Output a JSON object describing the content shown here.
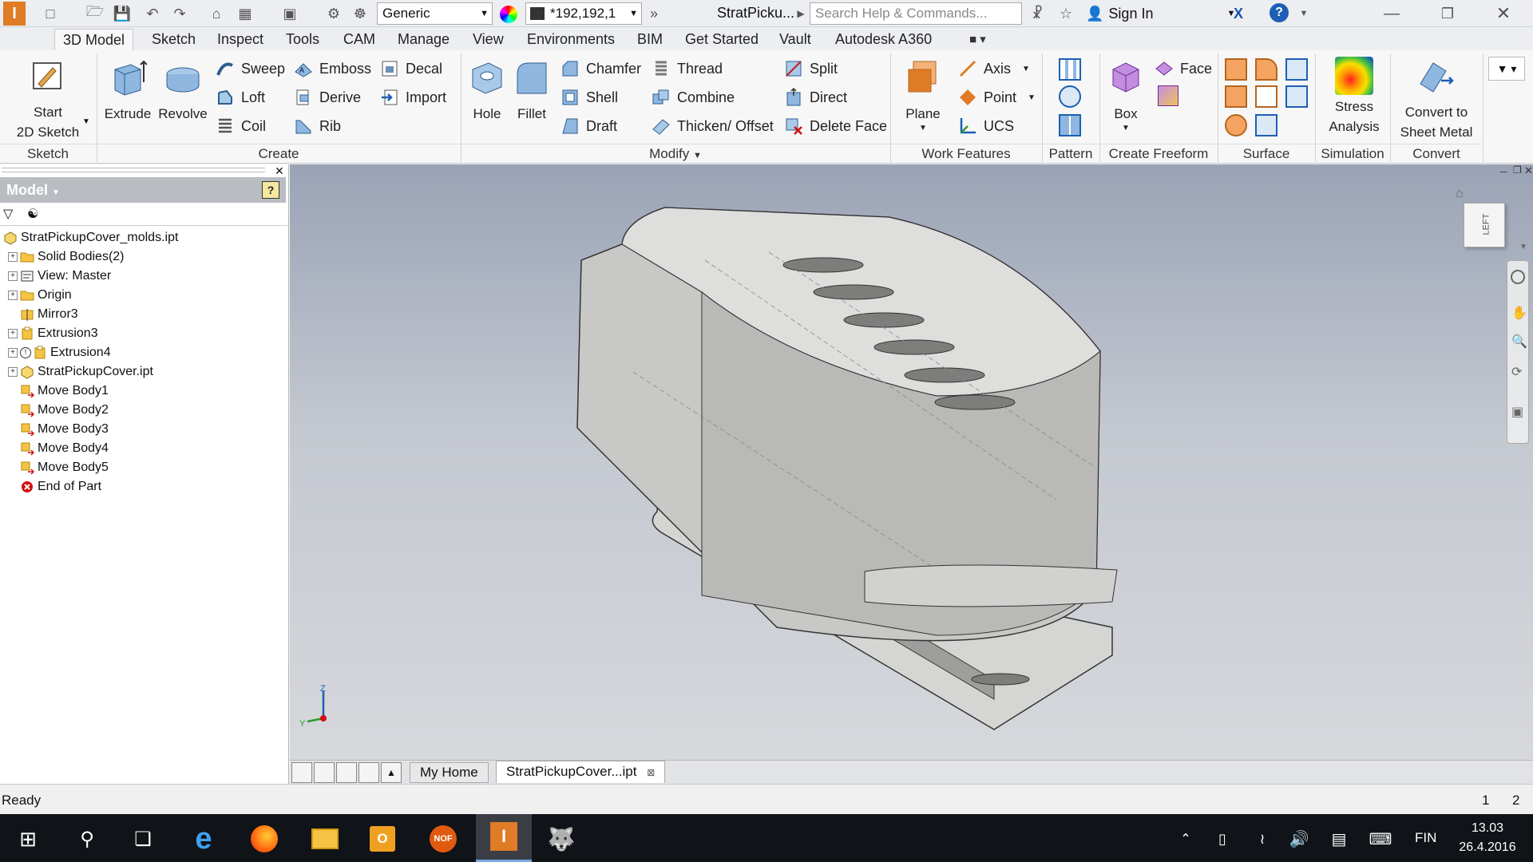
{
  "app": {
    "document_title": "StratPicku...",
    "search_placeholder": "Search Help & Commands...",
    "sign_in": "Sign In",
    "material": "Generic",
    "appearance": "*192,192,1"
  },
  "tabs": [
    {
      "label": "3D Model",
      "active": true
    },
    {
      "label": "Sketch"
    },
    {
      "label": "Inspect"
    },
    {
      "label": "Tools"
    },
    {
      "label": "CAM"
    },
    {
      "label": "Manage"
    },
    {
      "label": "View"
    },
    {
      "label": "Environments"
    },
    {
      "label": "BIM"
    },
    {
      "label": "Get Started"
    },
    {
      "label": "Vault"
    },
    {
      "label": "Autodesk A360"
    }
  ],
  "ribbon": {
    "sketch": {
      "label": "Sketch",
      "start_line1": "Start",
      "start_line2": "2D Sketch"
    },
    "create": {
      "label": "Create",
      "extrude": "Extrude",
      "revolve": "Revolve",
      "sweep": "Sweep",
      "loft": "Loft",
      "coil": "Coil",
      "emboss": "Emboss",
      "derive": "Derive",
      "rib": "Rib",
      "decal": "Decal",
      "import": "Import"
    },
    "modify": {
      "label": "Modify",
      "hole": "Hole",
      "fillet": "Fillet",
      "chamfer": "Chamfer",
      "shell": "Shell",
      "draft": "Draft",
      "thread": "Thread",
      "combine": "Combine",
      "thicken": "Thicken/ Offset",
      "split": "Split",
      "direct": "Direct",
      "delete_face": "Delete Face"
    },
    "work_features": {
      "label": "Work Features",
      "plane": "Plane",
      "axis": "Axis",
      "point": "Point",
      "ucs": "UCS"
    },
    "pattern": {
      "label": "Pattern"
    },
    "freeform": {
      "label": "Create Freeform",
      "box": "Box",
      "face": "Face"
    },
    "surface": {
      "label": "Surface"
    },
    "simulation": {
      "label": "Simulation",
      "stress_line1": "Stress",
      "stress_line2": "Analysis"
    },
    "convert": {
      "label": "Convert",
      "convert_line1": "Convert to",
      "convert_line2": "Sheet Metal"
    }
  },
  "browser": {
    "title": "Model",
    "items": [
      {
        "label": "StratPickupCover_molds.ipt",
        "level": 0,
        "expander": false,
        "icon": "part-icon"
      },
      {
        "label": "Solid Bodies(2)",
        "level": 1,
        "expander": true,
        "icon": "folder-icon"
      },
      {
        "label": "View: Master",
        "level": 1,
        "expander": true,
        "icon": "view-icon"
      },
      {
        "label": "Origin",
        "level": 1,
        "expander": true,
        "icon": "folder-icon"
      },
      {
        "label": "Mirror3",
        "level": 1,
        "expander": false,
        "icon": "mirror-icon"
      },
      {
        "label": "Extrusion3",
        "level": 1,
        "expander": true,
        "icon": "extrude-icon"
      },
      {
        "label": "Extrusion4",
        "level": 1,
        "expander": true,
        "icon": "extrude-icon"
      },
      {
        "label": "StratPickupCover.ipt",
        "level": 1,
        "expander": true,
        "icon": "part-icon"
      },
      {
        "label": "Move Body1",
        "level": 1,
        "expander": false,
        "icon": "move-body-icon"
      },
      {
        "label": "Move Body2",
        "level": 1,
        "expander": false,
        "icon": "move-body-icon"
      },
      {
        "label": "Move Body3",
        "level": 1,
        "expander": false,
        "icon": "move-body-icon"
      },
      {
        "label": "Move Body4",
        "level": 1,
        "expander": false,
        "icon": "move-body-icon"
      },
      {
        "label": "Move Body5",
        "level": 1,
        "expander": false,
        "icon": "move-body-icon"
      },
      {
        "label": "End of Part",
        "level": 1,
        "expander": false,
        "icon": "end-of-part-icon"
      }
    ]
  },
  "viewcube": {
    "face": "LEFT"
  },
  "doc_tabs": {
    "home": "My Home",
    "doc": "StratPickupCover...ipt"
  },
  "status": {
    "text": "Ready",
    "num1": "1",
    "num2": "2"
  },
  "taskbar": {
    "time": "13.03",
    "date": "26.4.2016",
    "lang": "FIN"
  },
  "colors": {
    "accent": "#e07b26",
    "ribbon_bg": "#f7f7f7",
    "model_gray": "#c8c8c6"
  }
}
